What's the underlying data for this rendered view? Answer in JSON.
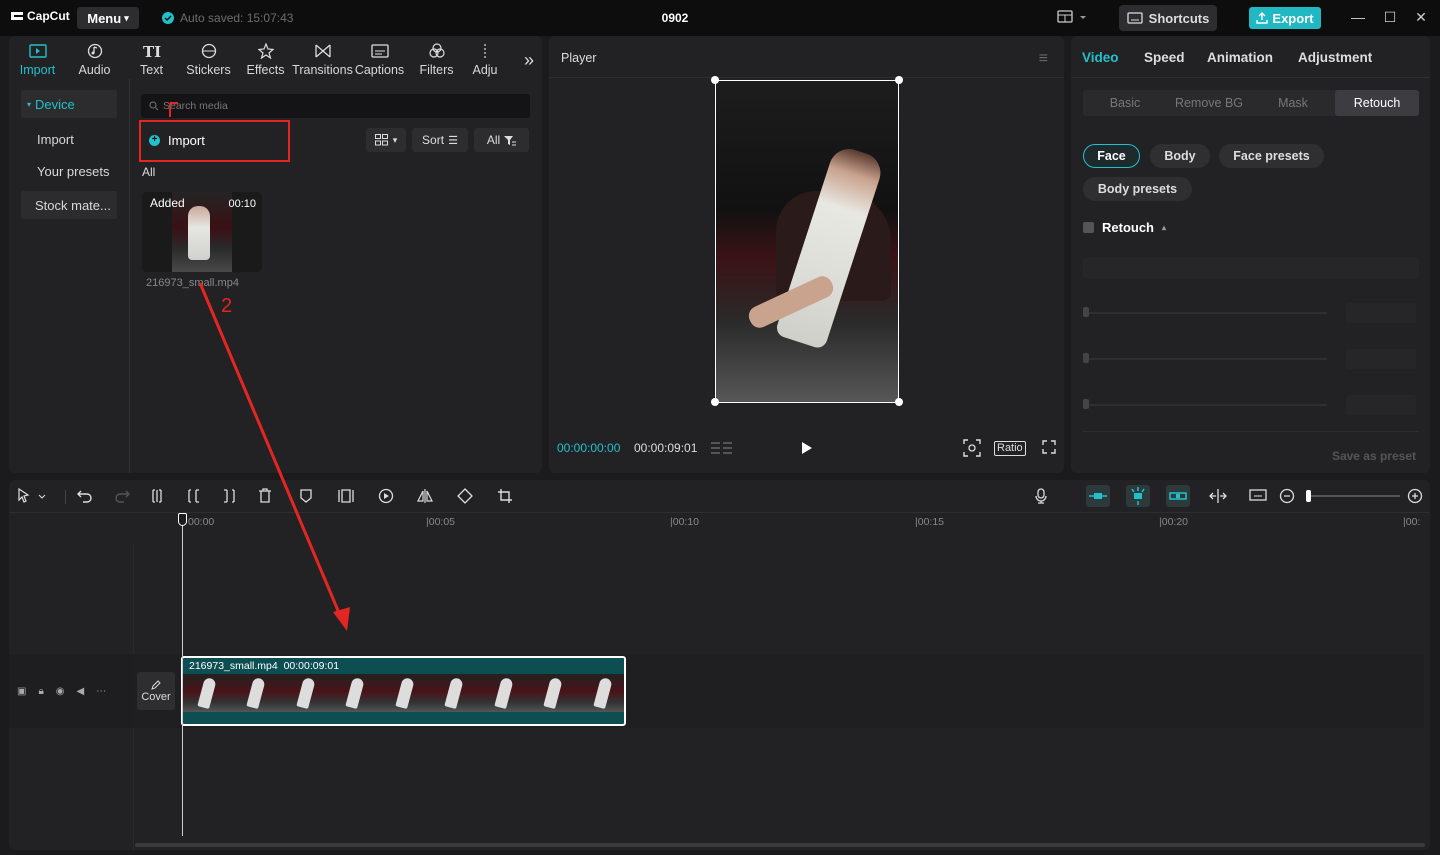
{
  "titlebar": {
    "logo": "CapCut",
    "menu_label": "Menu",
    "autosave": "Auto saved: 15:07:43",
    "project_title": "0902",
    "shortcuts_label": "Shortcuts",
    "export_label": "Export"
  },
  "media": {
    "tabs": [
      "Import",
      "Audio",
      "Text",
      "Stickers",
      "Effects",
      "Transitions",
      "Captions",
      "Filters",
      "Adju"
    ],
    "side_nav": [
      "Device",
      "Import",
      "Your presets",
      "Stock mate..."
    ],
    "search_placeholder": "Search media",
    "import_label": "Import",
    "sort_label": "Sort",
    "all_filter_label": "All",
    "all_label": "All",
    "card": {
      "badge": "Added",
      "duration": "00:10",
      "filename": "216973_small.mp4"
    },
    "annotation_number": "2"
  },
  "player": {
    "title": "Player",
    "current_time": "00:00:00:00",
    "total_time": "00:00:09:01",
    "ratio_label": "Ratio"
  },
  "inspector": {
    "tabs": [
      "Video",
      "Speed",
      "Animation",
      "Adjustment"
    ],
    "sub_tabs": [
      "Basic",
      "Remove BG",
      "Mask",
      "Retouch"
    ],
    "chips": [
      "Face",
      "Body",
      "Face presets",
      "Body presets"
    ],
    "retouch_label": "Retouch",
    "save_preset": "Save as preset"
  },
  "timeline": {
    "ruler_labels": [
      "00:00",
      "00:05",
      "00:10",
      "00:15",
      "00:20",
      "00:"
    ],
    "cover_label": "Cover",
    "clip_name": "216973_small.mp4",
    "clip_duration": "00:00:09:01"
  },
  "colors": {
    "accent": "#21c1cc",
    "annotation": "#e42622",
    "clip": "#0c4e51"
  }
}
